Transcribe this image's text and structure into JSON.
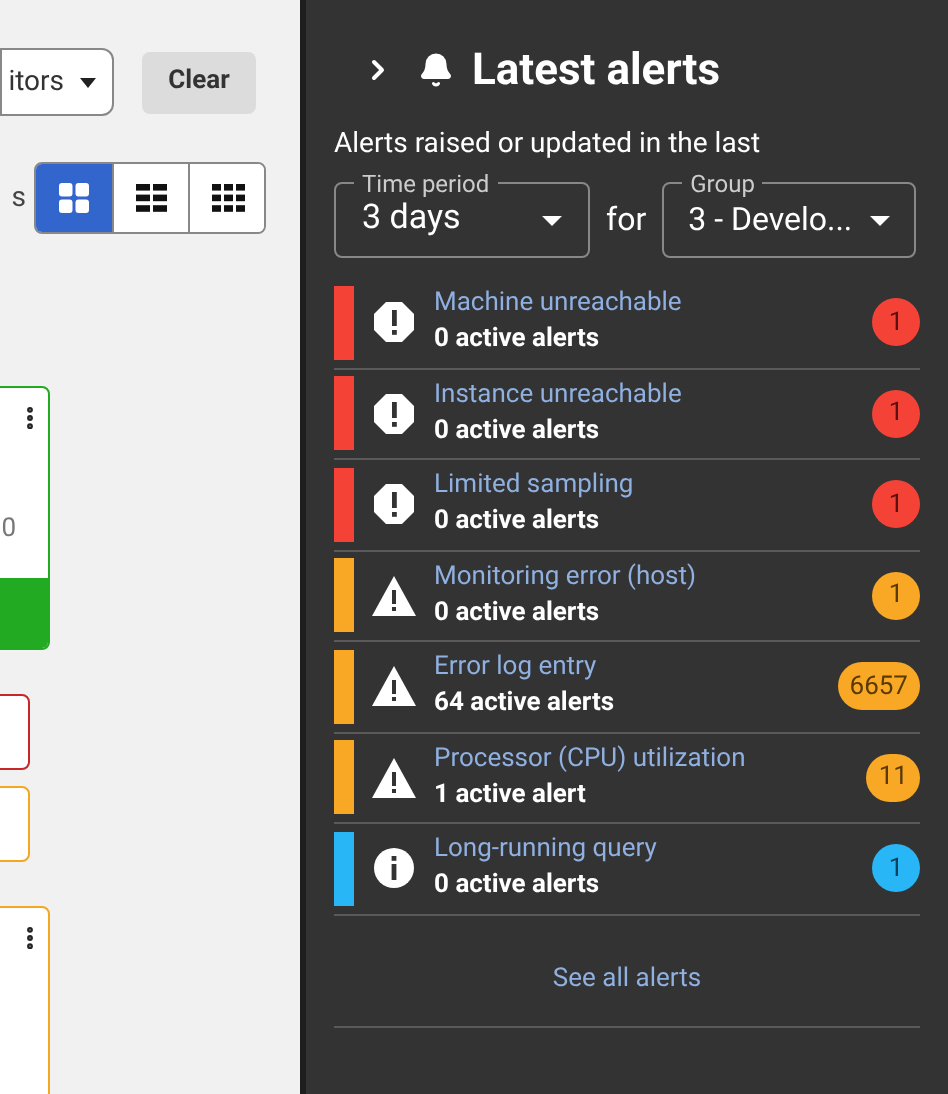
{
  "filter": {
    "dropdown_value": "itors",
    "clear_label": "Clear",
    "view_label": "s",
    "views": [
      {
        "selected": true
      },
      {
        "selected": false
      },
      {
        "selected": false
      }
    ]
  },
  "cards": [
    {
      "kind": "tile",
      "color": "#22aa22",
      "text": "0",
      "footer": true
    },
    {
      "kind": "strip",
      "color": "#c62828"
    },
    {
      "kind": "strip",
      "color": "#f5a623"
    },
    {
      "kind": "tile",
      "color": "#f5a623"
    }
  ],
  "alerts_panel": {
    "title": "Latest alerts",
    "subtitle": "Alerts raised or updated in the last",
    "time_period": {
      "label": "Time period",
      "value": "3 days"
    },
    "connector": "for",
    "group": {
      "label": "Group",
      "value": "3 - Develo..."
    },
    "alerts": [
      {
        "kind": "error",
        "name": "Machine unreachable",
        "active": "0 active alerts",
        "count": "1"
      },
      {
        "kind": "error",
        "name": "Instance unreachable",
        "active": "0 active alerts",
        "count": "1"
      },
      {
        "kind": "error",
        "name": "Limited sampling",
        "active": "0 active alerts",
        "count": "1"
      },
      {
        "kind": "warning",
        "name": "Monitoring error (host)",
        "active": "0 active alerts",
        "count": "1"
      },
      {
        "kind": "warning",
        "name": "Error log entry",
        "active": "64 active alerts",
        "count": "6657"
      },
      {
        "kind": "warning",
        "name": "Processor (CPU) utilization",
        "active": "1 active alert",
        "count": "11"
      },
      {
        "kind": "info",
        "name": "Long-running query",
        "active": "0 active alerts",
        "count": "1"
      }
    ],
    "see_all": "See all alerts"
  }
}
